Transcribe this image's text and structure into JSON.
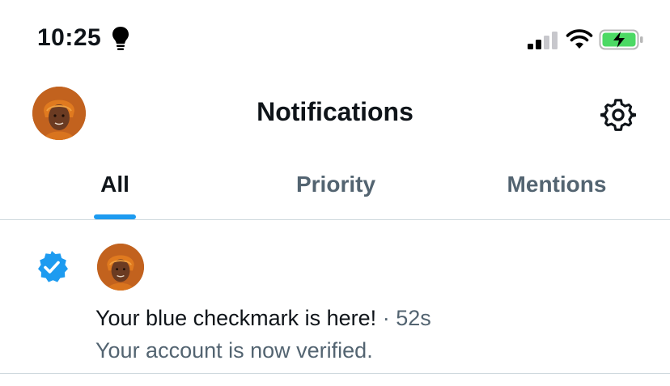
{
  "status_bar": {
    "time": "10:25",
    "icons": [
      "lightbulb-icon",
      "cellular-signal-icon",
      "wifi-icon",
      "battery-charging-icon"
    ],
    "battery_color": "#4cd964"
  },
  "header": {
    "title": "Notifications",
    "settings_icon": "gear-icon"
  },
  "tabs": [
    {
      "label": "All",
      "active": true
    },
    {
      "label": "Priority",
      "active": false
    },
    {
      "label": "Mentions",
      "active": false
    }
  ],
  "notifications": [
    {
      "icon": "verified-badge-icon",
      "title": "Your blue checkmark is here!",
      "separator": " · ",
      "time": "52s",
      "subtitle": "Your account is now verified."
    }
  ],
  "colors": {
    "accent": "#1d9bf0",
    "text_primary": "#0f1419",
    "text_secondary": "#536471",
    "divider": "#cfd9de"
  }
}
